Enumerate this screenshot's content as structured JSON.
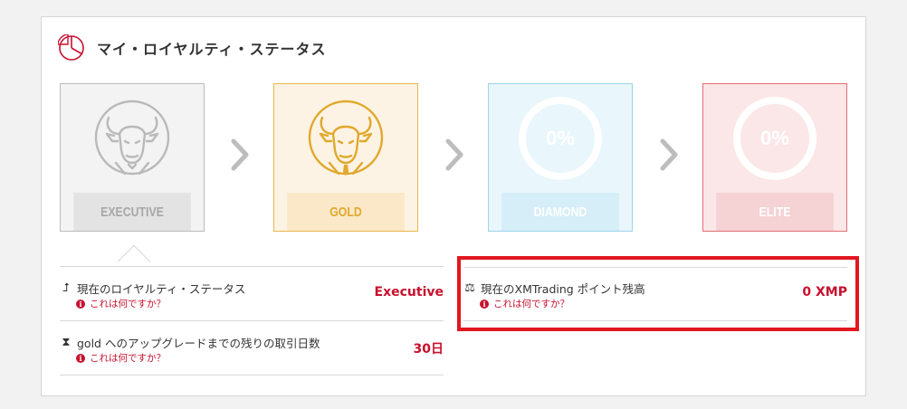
{
  "panel": {
    "title": "マイ・ロイヤルティ・ステータス",
    "title_icon": "pie-chart-icon"
  },
  "tiers": [
    {
      "name": "EXECUTIVE",
      "visual": "bull-icon",
      "state": "current"
    },
    {
      "name": "GOLD",
      "visual": "bull-icon",
      "state": "next"
    },
    {
      "name": "DIAMOND",
      "progress_label": "0%",
      "progress": 0
    },
    {
      "name": "ELITE",
      "progress_label": "0%",
      "progress": 0
    }
  ],
  "rows": {
    "status": {
      "label": "現在のロイヤルティ・ステータス",
      "help": "これは何ですか？",
      "value": "Executive",
      "icon": "upgrade-arrow-icon"
    },
    "days": {
      "label": "gold へのアップグレードまでの残りの取引日数",
      "help": "これは何ですか？",
      "value": "30日",
      "icon": "hourglass-icon"
    },
    "points": {
      "label": "現在のXMTrading ポイント残高",
      "help": "これは何ですか？",
      "value": "0 XMP",
      "icon": "scale-icon"
    }
  },
  "colors": {
    "accent_red": "#c8102e",
    "highlight_border": "#e2171f",
    "gold": "#e0a92c",
    "diamond": "#9dd4e8",
    "elite": "#e26e74"
  }
}
